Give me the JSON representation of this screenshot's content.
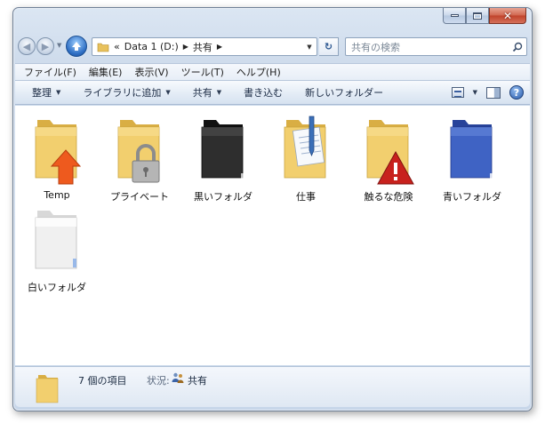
{
  "window": {
    "caption_buttons": [
      "minimize",
      "maximize",
      "close"
    ]
  },
  "navigation": {
    "address_prefix": "«",
    "breadcrumbs": [
      "Data 1 (D:)",
      "共有"
    ],
    "search_placeholder": "共有の検索"
  },
  "menu": {
    "items": [
      "ファイル(F)",
      "編集(E)",
      "表示(V)",
      "ツール(T)",
      "ヘルプ(H)"
    ]
  },
  "commands": {
    "items": [
      {
        "label": "整理",
        "has_dropdown": true
      },
      {
        "label": "ライブラリに追加",
        "has_dropdown": true
      },
      {
        "label": "共有",
        "has_dropdown": true
      },
      {
        "label": "書き込む",
        "has_dropdown": false
      },
      {
        "label": "新しいフォルダー",
        "has_dropdown": false
      }
    ],
    "help_glyph": "?"
  },
  "folders": [
    {
      "label": "Temp",
      "icon": "folder-up-arrow-icon",
      "color": "#f2cf6e",
      "badge_color": "#ee5a1e"
    },
    {
      "label": "プライベート",
      "icon": "folder-padlock-icon",
      "color": "#f2cf6e",
      "badge_color": "#9a9a9a"
    },
    {
      "label": "黒いフォルダ",
      "icon": "black-folder-icon",
      "color": "#2e2e2e"
    },
    {
      "label": "仕事",
      "icon": "folder-document-pen-icon",
      "color": "#f2cf6e",
      "badge_color": "#3b6fb8"
    },
    {
      "label": "触るな危険",
      "icon": "folder-warning-icon",
      "color": "#f2cf6e",
      "badge_color": "#c8211d"
    },
    {
      "label": "青いフォルダ",
      "icon": "blue-folder-icon",
      "color": "#3f63c4"
    },
    {
      "label": "白いフォルダ",
      "icon": "white-folder-icon",
      "color": "#f0f0f0"
    }
  ],
  "details": {
    "item_count": "7 個の項目",
    "status_label": "状況:",
    "status_icon": "shared-users-icon",
    "status_value": "共有"
  }
}
